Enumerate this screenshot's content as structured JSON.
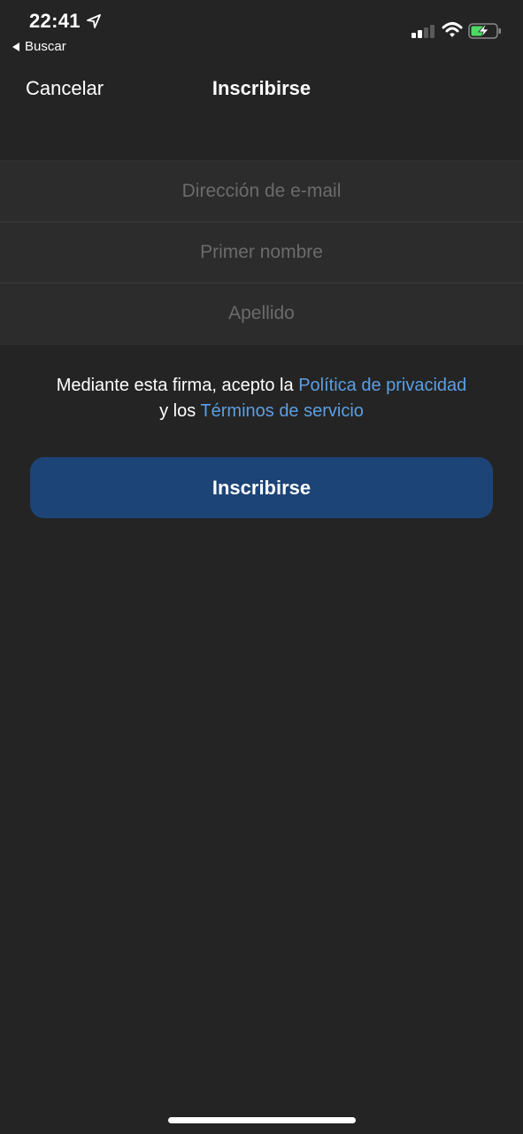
{
  "status_bar": {
    "time": "22:41",
    "back_app_label": "Buscar",
    "icons": [
      "location-arrow-icon",
      "cellular-signal-icon",
      "wifi-icon",
      "battery-charging-icon"
    ],
    "battery_color": "#4cd964"
  },
  "nav": {
    "cancel_label": "Cancelar",
    "title": "Inscribirse"
  },
  "form": {
    "email_placeholder": "Dirección de e-mail",
    "first_name_placeholder": "Primer nombre",
    "last_name_placeholder": "Apellido"
  },
  "terms": {
    "prefix": "Mediante esta firma, acepto la ",
    "privacy_link": "Política de privacidad",
    "middle": " y los ",
    "terms_link": "Términos de servicio"
  },
  "actions": {
    "signup_label": "Inscribirse"
  },
  "colors": {
    "background": "#242424",
    "link": "#5b9fe3",
    "primary_button": "#1d4477"
  }
}
